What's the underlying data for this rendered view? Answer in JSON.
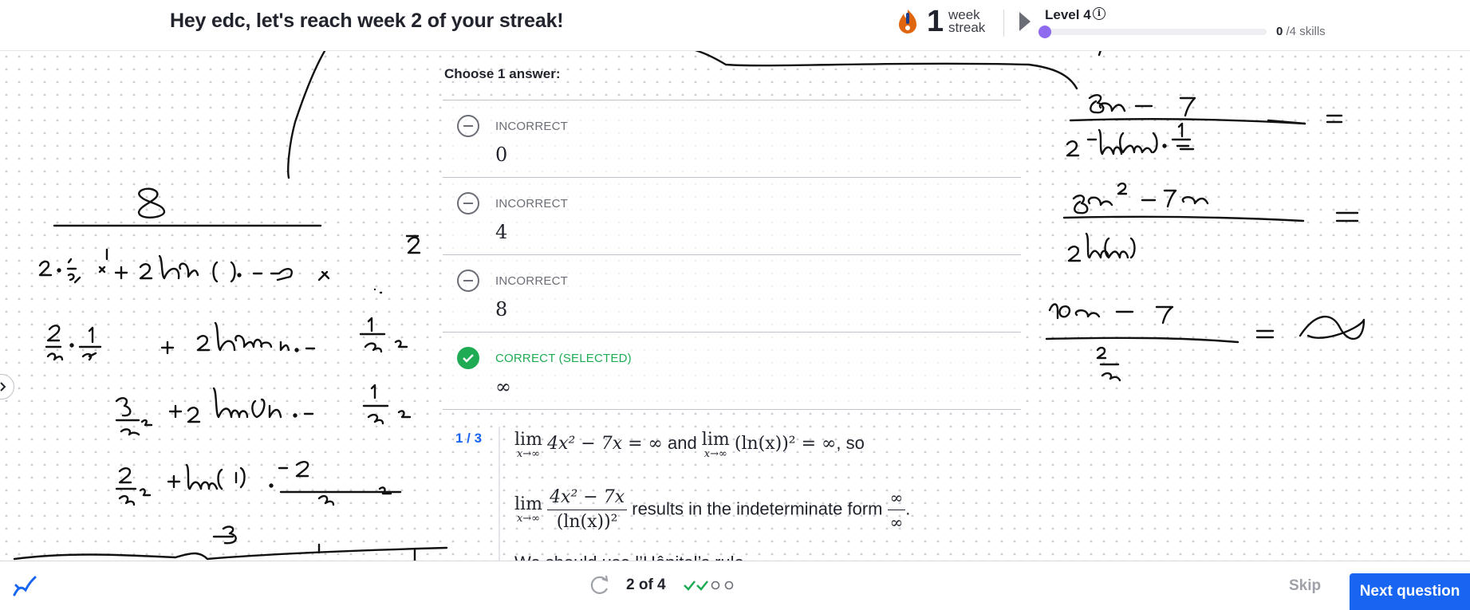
{
  "header": {
    "title": "Hey edc, let's reach week 2 of your streak!",
    "streak_count": "1",
    "streak_line1": "week",
    "streak_line2": "streak",
    "level_label": "Level 4",
    "info_glyph": "i",
    "skills_done": "0",
    "skills_total": " /4 skills",
    "level_progress": 0
  },
  "exercise": {
    "choose_label": "Choose 1 answer:",
    "choices": [
      {
        "status": "INCORRECT",
        "value": "0"
      },
      {
        "status": "INCORRECT",
        "value": "4"
      },
      {
        "status": "INCORRECT",
        "value": "8"
      },
      {
        "status": "CORRECT (SELECTED)",
        "value": "∞"
      }
    ],
    "hint": {
      "step": "1 / 3",
      "lim_word": "lim",
      "lim_sub": "x→∞",
      "expr1": "4x² − 7x = ∞",
      "and_word": " and ",
      "expr2": "(ln(x))² = ∞",
      "so_word": ", so",
      "frac_num": "4x² − 7x",
      "frac_den": "(ln(x))²",
      "indeterminate_text": " results in the indeterminate form ",
      "inf_num": "∞",
      "inf_den": "∞",
      "period": ".",
      "next_line": "We should use l’Hôpital’s rule."
    }
  },
  "footer": {
    "counter": "2 of 4",
    "skip_label": "Skip",
    "next_label": "Next question",
    "progress_dots": [
      "done",
      "done",
      "empty",
      "empty"
    ]
  },
  "colors": {
    "accent_blue": "#1865f2",
    "correct_green": "#1fab54",
    "streak_orange": "#e0650f",
    "level_purple": "#8f6bf0"
  },
  "icons": [
    "streak-flame-icon",
    "play-icon",
    "info-icon",
    "minus-circle-icon",
    "check-circle-icon",
    "pen-icon",
    "refresh-icon",
    "check-icon",
    "circle-icon",
    "chevron-right-icon"
  ]
}
